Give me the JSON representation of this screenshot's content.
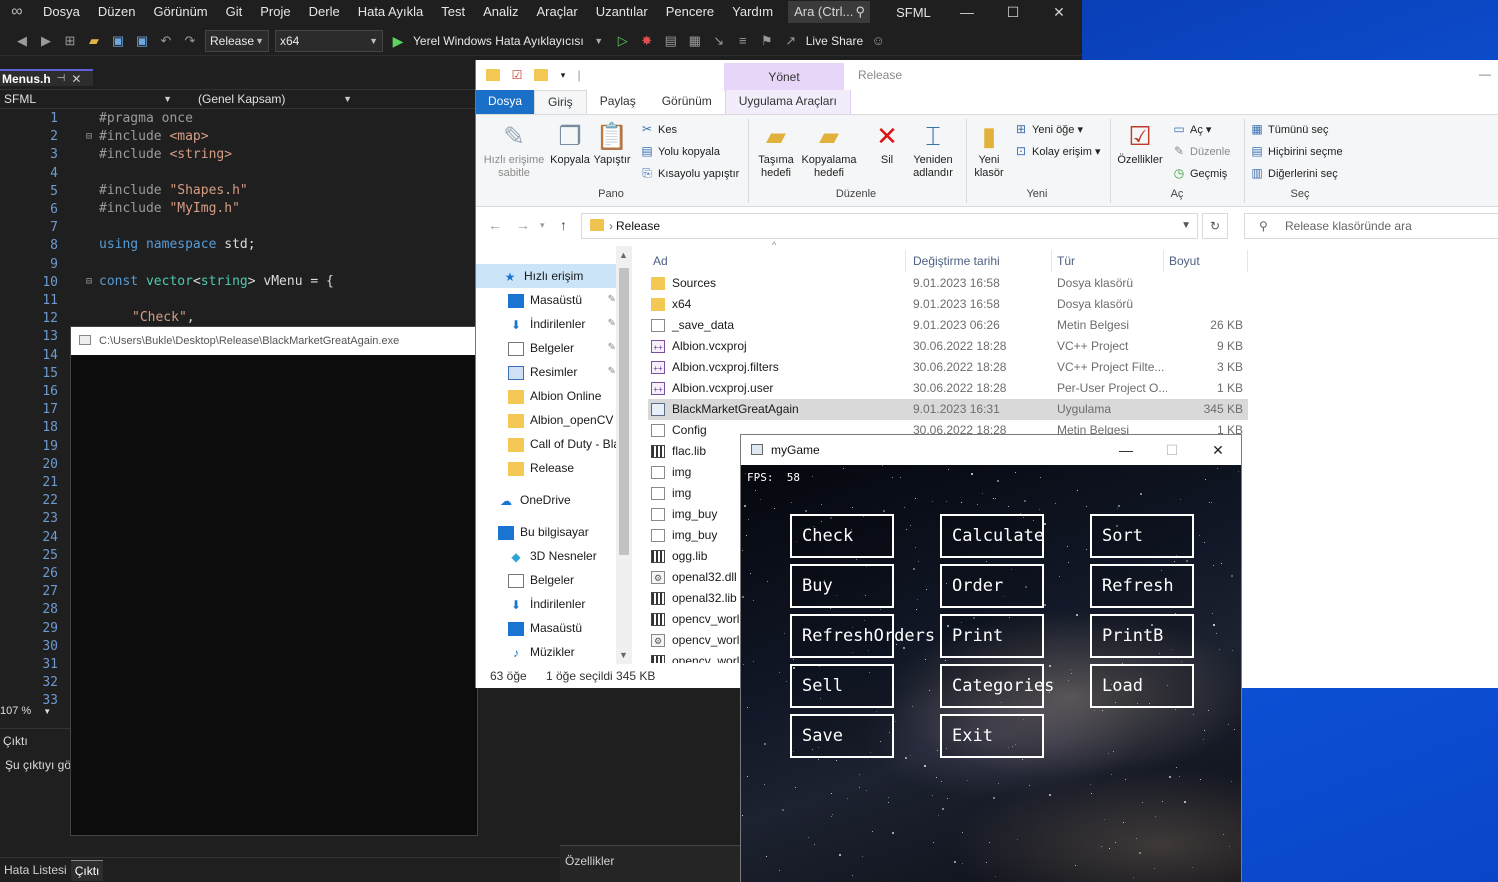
{
  "vs": {
    "menu": [
      "Dosya",
      "Düzen",
      "Görünüm",
      "Git",
      "Proje",
      "Derle",
      "Hata Ayıkla",
      "Test",
      "Analiz",
      "Araçlar",
      "Uzantılar",
      "Pencere",
      "Yardım"
    ],
    "search": "Ara (Ctrl...",
    "solution": "SFML",
    "toolbar": {
      "config": "Release",
      "platform": "x64",
      "debugger": "Yerel Windows Hata Ayıklayıcısı",
      "live_share": "Live Share"
    },
    "tab": "Menus.h",
    "nav_project": "SFML",
    "nav_scope": "(Genel Kapsam)",
    "zoom": "107 %",
    "output_title": "Çıktı",
    "output_text": "Şu çıktıyı gö",
    "bottom_tabs": [
      "Hata Listesi",
      "Çıktı"
    ],
    "props": "Özellikler",
    "lines": [
      "1",
      "2",
      "3",
      "4",
      "5",
      "6",
      "7",
      "8",
      "9",
      "10",
      "11",
      "12",
      "13",
      "14",
      "15",
      "16",
      "17",
      "18",
      "19",
      "20",
      "21",
      "22",
      "23",
      "24",
      "25",
      "26",
      "27",
      "28",
      "29",
      "30",
      "31",
      "32",
      "33"
    ],
    "code": {
      "l1": "#pragma once",
      "l2a": "#include ",
      "l2b": "<map>",
      "l3a": "#include ",
      "l3b": "<string>",
      "l5a": "#include ",
      "l5b": "\"Shapes.h\"",
      "l6a": "#include ",
      "l6b": "\"MyImg.h\"",
      "l8a": "using",
      "l8b": " namespace",
      "l8c": " std;",
      "l10a": "const",
      "l10b": " vector",
      "l10c": "<",
      "l10d": "string",
      "l10e": "> vMenu = {",
      "l12a": "\"Check\"",
      "l12b": ","
    }
  },
  "console": {
    "title": "C:\\Users\\Bukle\\Desktop\\Release\\BlackMarketGreatAgain.exe"
  },
  "explorer": {
    "title": "Release",
    "ctx_head": "Yönet",
    "tabs": [
      "Dosya",
      "Giriş",
      "Paylaş",
      "Görünüm",
      "Uygulama Araçları"
    ],
    "ribbon": {
      "pin": "Hızlı erişime sabitle",
      "copy": "Kopyala",
      "paste": "Yapıştır",
      "cut": "Kes",
      "copy_path": "Yolu kopyala",
      "paste_shortcut": "Kısayolu yapıştır",
      "group_clip": "Pano",
      "move_to": "Taşıma hedefi",
      "copy_to": "Kopyalama hedefi",
      "delete": "Sil",
      "rename": "Yeniden adlandır",
      "group_org": "Düzenle",
      "new_folder": "Yeni klasör",
      "new_item": "Yeni öğe",
      "easy_access": "Kolay erişim",
      "group_new": "Yeni",
      "properties": "Özellikler",
      "open": "Aç",
      "edit": "Düzenle",
      "history": "Geçmiş",
      "group_open": "Aç",
      "select_all": "Tümünü seç",
      "select_none": "Hiçbirini seçme",
      "invert": "Diğerlerini seç",
      "group_select": "Seç"
    },
    "address": "Release",
    "search_placeholder": "Release klasöründe ara",
    "nav": [
      "Hızlı erişim",
      "Masaüstü",
      "İndirilenler",
      "Belgeler",
      "Resimler",
      "Albion Online",
      "Albion_openCV",
      "Call of Duty - Bla",
      "Release",
      "OneDrive",
      "Bu bilgisayar",
      "3D Nesneler",
      "Belgeler",
      "İndirilenler",
      "Masaüstü",
      "Müzikler"
    ],
    "columns": {
      "name": "Ad",
      "date": "Değiştirme tarihi",
      "type": "Tür",
      "size": "Boyut"
    },
    "files": [
      {
        "name": "Sources",
        "date": "9.01.2023 16:58",
        "type": "Dosya klasörü",
        "size": "",
        "icon": "folder"
      },
      {
        "name": "x64",
        "date": "9.01.2023 16:58",
        "type": "Dosya klasörü",
        "size": "",
        "icon": "folder"
      },
      {
        "name": "_save_data",
        "date": "9.01.2023 06:26",
        "type": "Metin Belgesi",
        "size": "26 KB",
        "icon": "doc"
      },
      {
        "name": "Albion.vcxproj",
        "date": "30.06.2022 18:28",
        "type": "VC++ Project",
        "size": "9 KB",
        "icon": "vc"
      },
      {
        "name": "Albion.vcxproj.filters",
        "date": "30.06.2022 18:28",
        "type": "VC++ Project Filte...",
        "size": "3 KB",
        "icon": "vc"
      },
      {
        "name": "Albion.vcxproj.user",
        "date": "30.06.2022 18:28",
        "type": "Per-User Project O...",
        "size": "1 KB",
        "icon": "vc"
      },
      {
        "name": "BlackMarketGreatAgain",
        "date": "9.01.2023 16:31",
        "type": "Uygulama",
        "size": "345 KB",
        "icon": "exe"
      },
      {
        "name": "Config",
        "date": "30.06.2022 18:28",
        "type": "Metin Belgesi",
        "size": "1 KB",
        "icon": "doc"
      },
      {
        "name": "flac.lib",
        "date": "",
        "type": "",
        "size": "",
        "icon": "lib"
      },
      {
        "name": "img",
        "date": "",
        "type": "",
        "size": "",
        "icon": "doc"
      },
      {
        "name": "img",
        "date": "",
        "type": "",
        "size": "",
        "icon": "doc"
      },
      {
        "name": "img_buy",
        "date": "",
        "type": "",
        "size": "",
        "icon": "doc"
      },
      {
        "name": "img_buy",
        "date": "",
        "type": "",
        "size": "",
        "icon": "doc"
      },
      {
        "name": "ogg.lib",
        "date": "",
        "type": "",
        "size": "",
        "icon": "lib"
      },
      {
        "name": "openal32.dll",
        "date": "",
        "type": "",
        "size": "",
        "icon": "dll"
      },
      {
        "name": "openal32.lib",
        "date": "",
        "type": "",
        "size": "",
        "icon": "lib"
      },
      {
        "name": "opencv_worl",
        "date": "",
        "type": "",
        "size": "",
        "icon": "lib"
      },
      {
        "name": "opencv_worl",
        "date": "",
        "type": "",
        "size": "",
        "icon": "dll"
      },
      {
        "name": "opencv_worl",
        "date": "",
        "type": "",
        "size": "",
        "icon": "lib"
      }
    ],
    "status_count": "63 öğe",
    "status_sel": "1 öğe seçildi  345 KB"
  },
  "game": {
    "title": "myGame",
    "fps": "FPS:  58",
    "buttons": [
      "Check",
      "Calculate",
      "Sort",
      "Buy",
      "Order",
      "Refresh",
      "RefreshOrders",
      "Print",
      "PrintB",
      "Sell",
      "Categories",
      "Load",
      "Save",
      "Exit"
    ]
  }
}
